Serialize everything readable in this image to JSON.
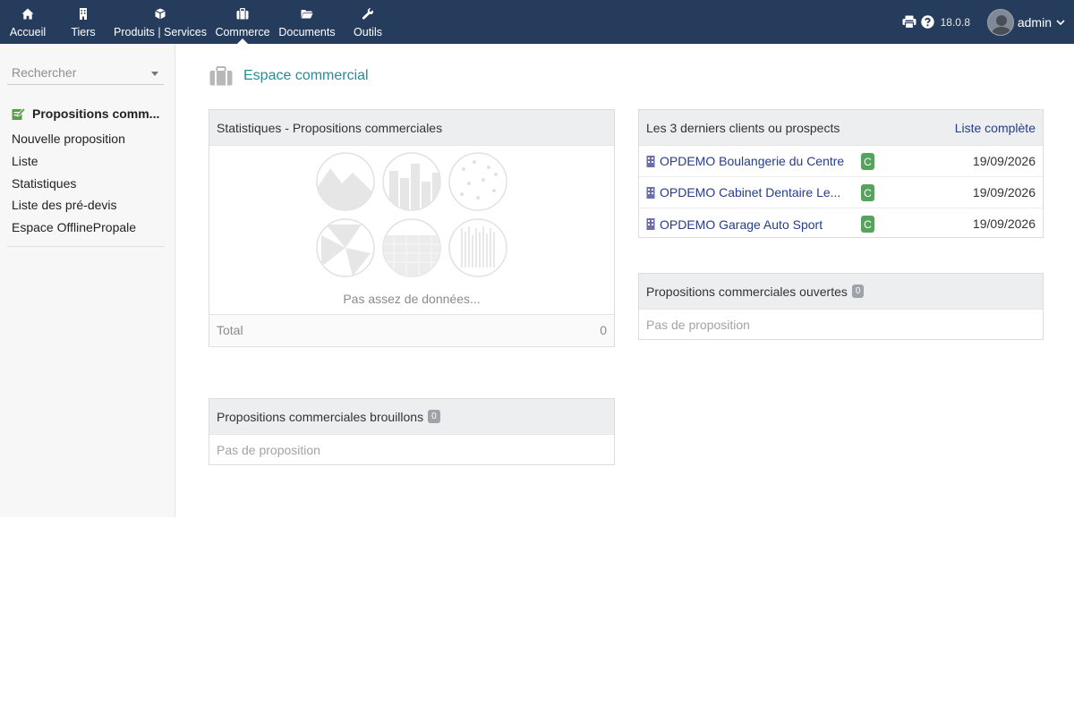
{
  "nav": {
    "items": [
      {
        "label": "Accueil",
        "icon": "home-icon"
      },
      {
        "label": "Tiers",
        "icon": "building-icon"
      },
      {
        "label": "Produits | Services",
        "icon": "cube-icon"
      },
      {
        "label": "Commerce",
        "icon": "briefcase-icon"
      },
      {
        "label": "Documents",
        "icon": "folder-icon"
      },
      {
        "label": "Outils",
        "icon": "wrench-icon"
      }
    ],
    "active": "Commerce",
    "version": "18.0.8",
    "user": "admin"
  },
  "sidebar": {
    "search_placeholder": "Rechercher",
    "title": "Propositions comm...",
    "items": [
      "Nouvelle proposition",
      "Liste",
      "Statistiques",
      "Liste des pré-devis",
      "Espace OfflinePropale"
    ]
  },
  "page": {
    "title": "Espace commercial"
  },
  "stats": {
    "title": "Statistiques - Propositions commerciales",
    "message": "Pas assez de données...",
    "total_label": "Total",
    "total_value": "0"
  },
  "drafts": {
    "title": "Propositions commerciales brouillons",
    "count": "0",
    "empty": "Pas de proposition"
  },
  "clients": {
    "title": "Les 3 derniers clients ou prospects",
    "full_list": "Liste complète",
    "rows": [
      {
        "name": "OPDEMO Boulangerie du Centre",
        "tag": "C",
        "date": "19/09/2026"
      },
      {
        "name": "OPDEMO Cabinet Dentaire Le...",
        "tag": "C",
        "date": "19/09/2026"
      },
      {
        "name": "OPDEMO Garage Auto Sport",
        "tag": "C",
        "date": "19/09/2026"
      }
    ]
  },
  "open": {
    "title": "Propositions commerciales ouvertes",
    "count": "0",
    "empty": "Pas de proposition"
  },
  "colors": {
    "topbar": "#263c5c",
    "link": "#263c8c",
    "title_accent": "#2b8a99",
    "tag_green": "#55a35c"
  }
}
